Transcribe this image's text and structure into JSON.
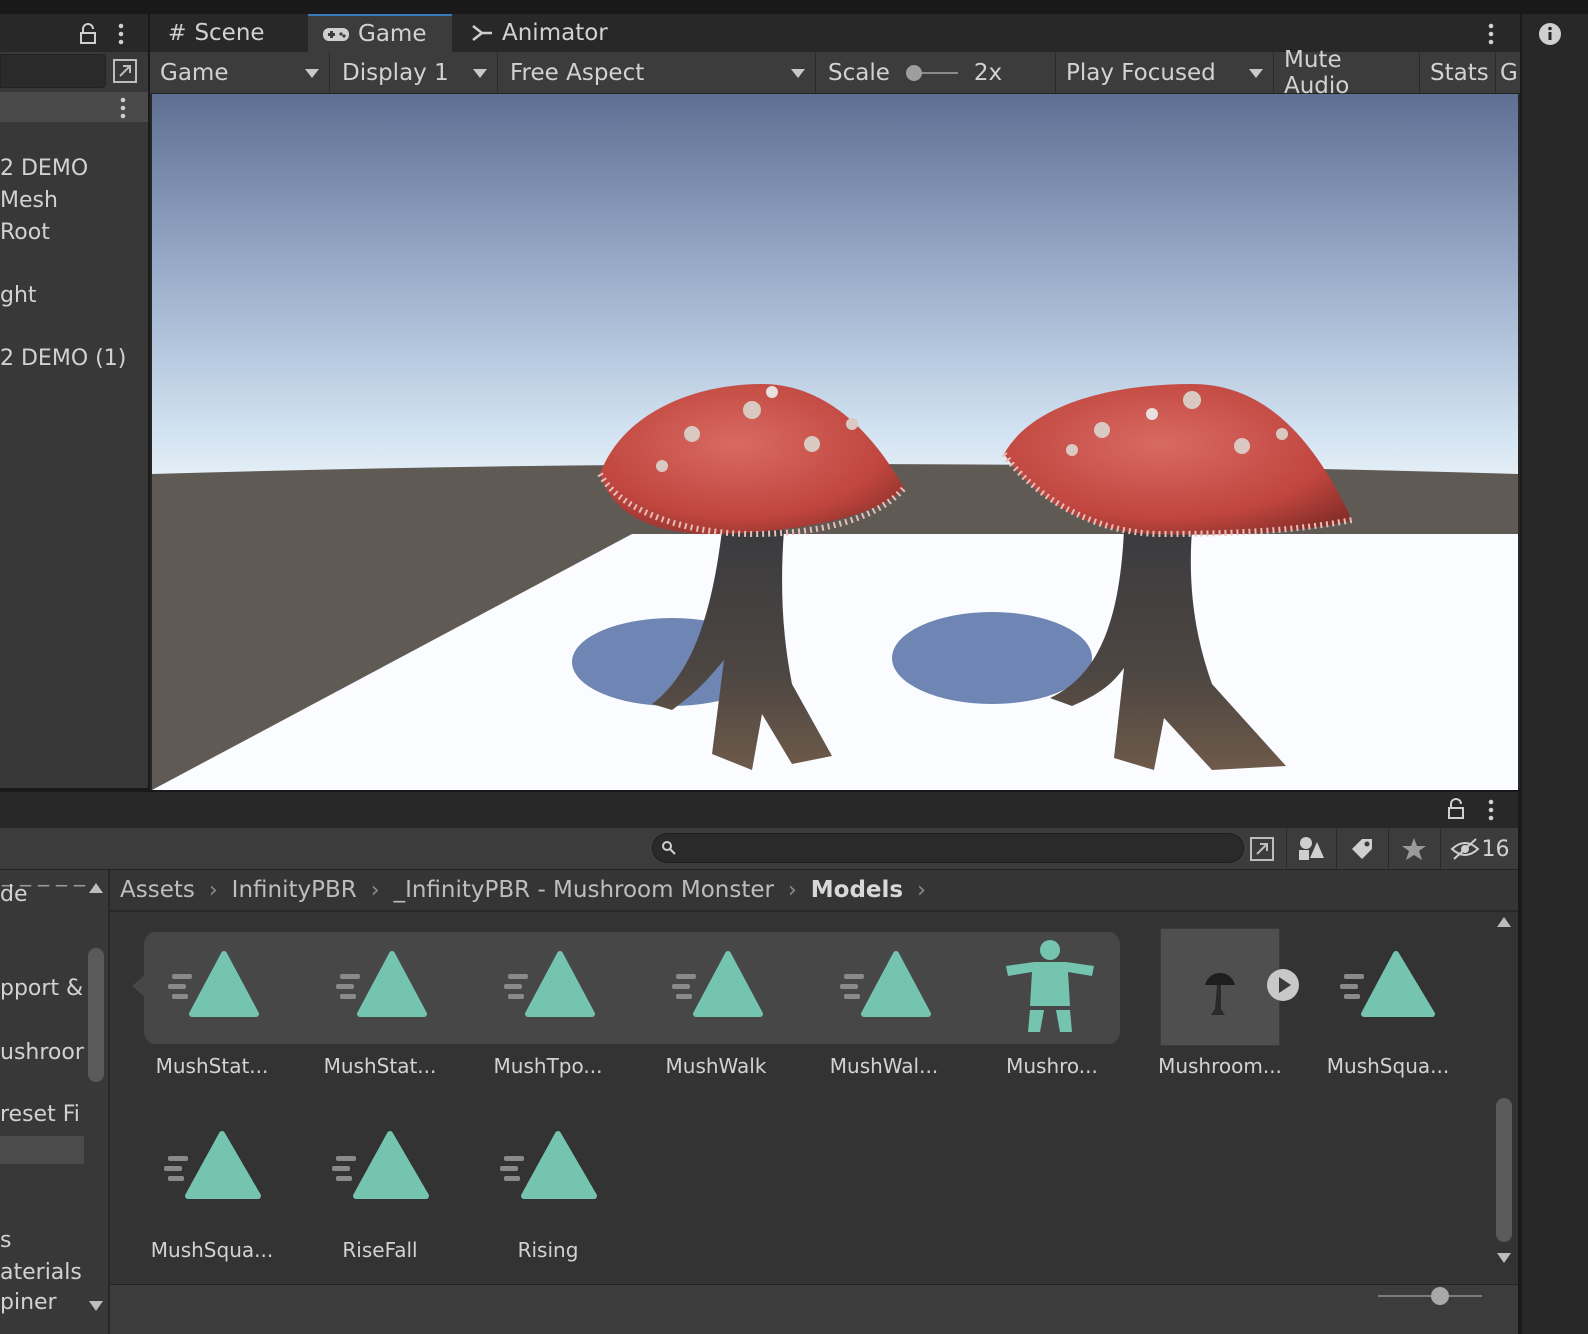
{
  "hierarchy": {
    "items": [
      "2 DEMO",
      "Mesh",
      "Root",
      "ght",
      "2 DEMO (1)"
    ]
  },
  "game_view": {
    "tabs": [
      {
        "label": "Scene",
        "icon": "grid-icon"
      },
      {
        "label": "Game",
        "icon": "gamepad-icon"
      },
      {
        "label": "Animator",
        "icon": "animator-icon"
      }
    ],
    "toolbar": {
      "mode_label": "Game",
      "display_label": "Display 1",
      "aspect_label": "Free Aspect",
      "scale_label": "Scale",
      "scale_value": "2x",
      "play_label": "Play Focused",
      "mute_label": "Mute Audio",
      "stats_label": "Stats",
      "gizmos_label": "G"
    }
  },
  "project": {
    "hidden_count": "16",
    "search_placeholder": "",
    "left_items": [
      "de",
      "pport &",
      "ushroor",
      "reset Fi",
      "s",
      "aterials",
      "piner"
    ],
    "breadcrumb": [
      "Assets",
      "InfinityPBR",
      "_InfinityPBR - Mushroom Monster",
      "Models"
    ],
    "assets_row1": [
      "MushStat...",
      "MushStat...",
      "MushTpo...",
      "MushWalk",
      "MushWal...",
      "Mushro...",
      "Mushroom...",
      "MushSqua..."
    ],
    "assets_row2": [
      "MushSqua...",
      "RiseFall",
      "Rising"
    ]
  },
  "colors": {
    "accent": "#3a79bb",
    "anim_icon": "#74c4b0",
    "panel": "#282828",
    "toolbar": "#3c3c3c"
  }
}
